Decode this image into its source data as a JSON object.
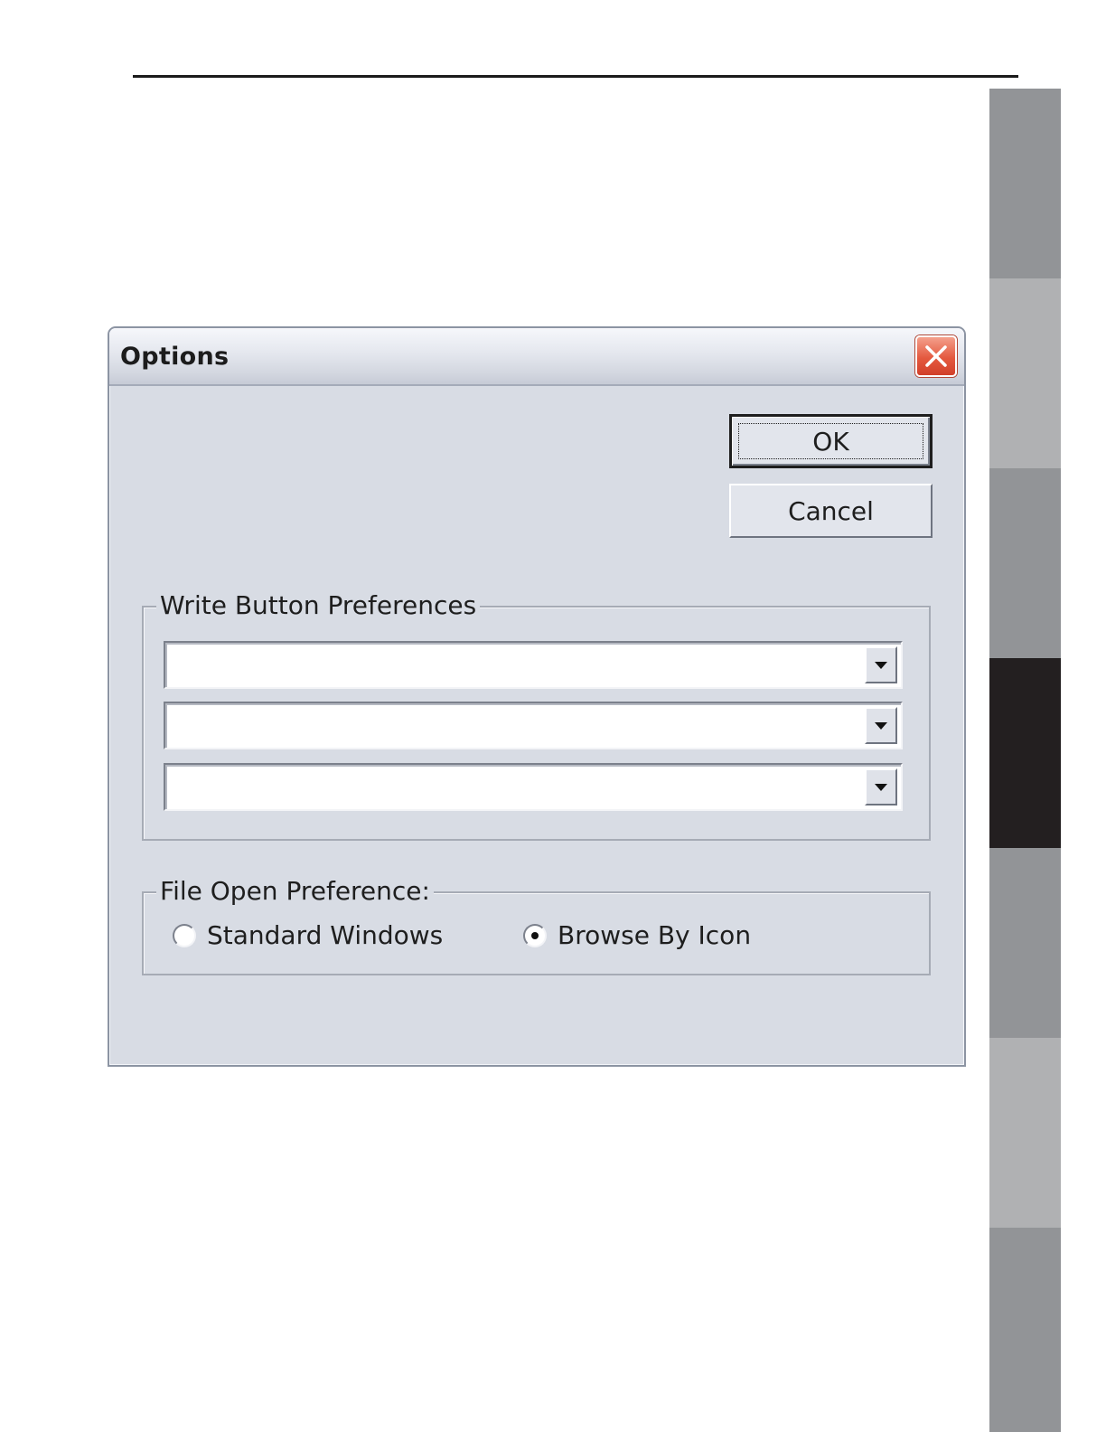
{
  "dialog": {
    "title": "Options",
    "ok_label": "OK",
    "cancel_label": "Cancel",
    "write_prefs": {
      "legend": "Write Button Preferences",
      "combos": [
        {
          "value": ""
        },
        {
          "value": ""
        },
        {
          "value": ""
        }
      ]
    },
    "file_open": {
      "legend": "File Open Preference:",
      "options": [
        {
          "label": "Standard Windows",
          "selected": false
        },
        {
          "label": "Browse By Icon",
          "selected": true
        }
      ]
    }
  },
  "colors": {
    "dialog_bg": "#d8dce4",
    "close_button": "#e4593f",
    "side_tab_active": "#231f20",
    "side_tab_dark": "#929497",
    "side_tab_light": "#b0b1b3"
  },
  "icons": {
    "close": "close-icon",
    "dropdown": "chevron-down-icon"
  }
}
